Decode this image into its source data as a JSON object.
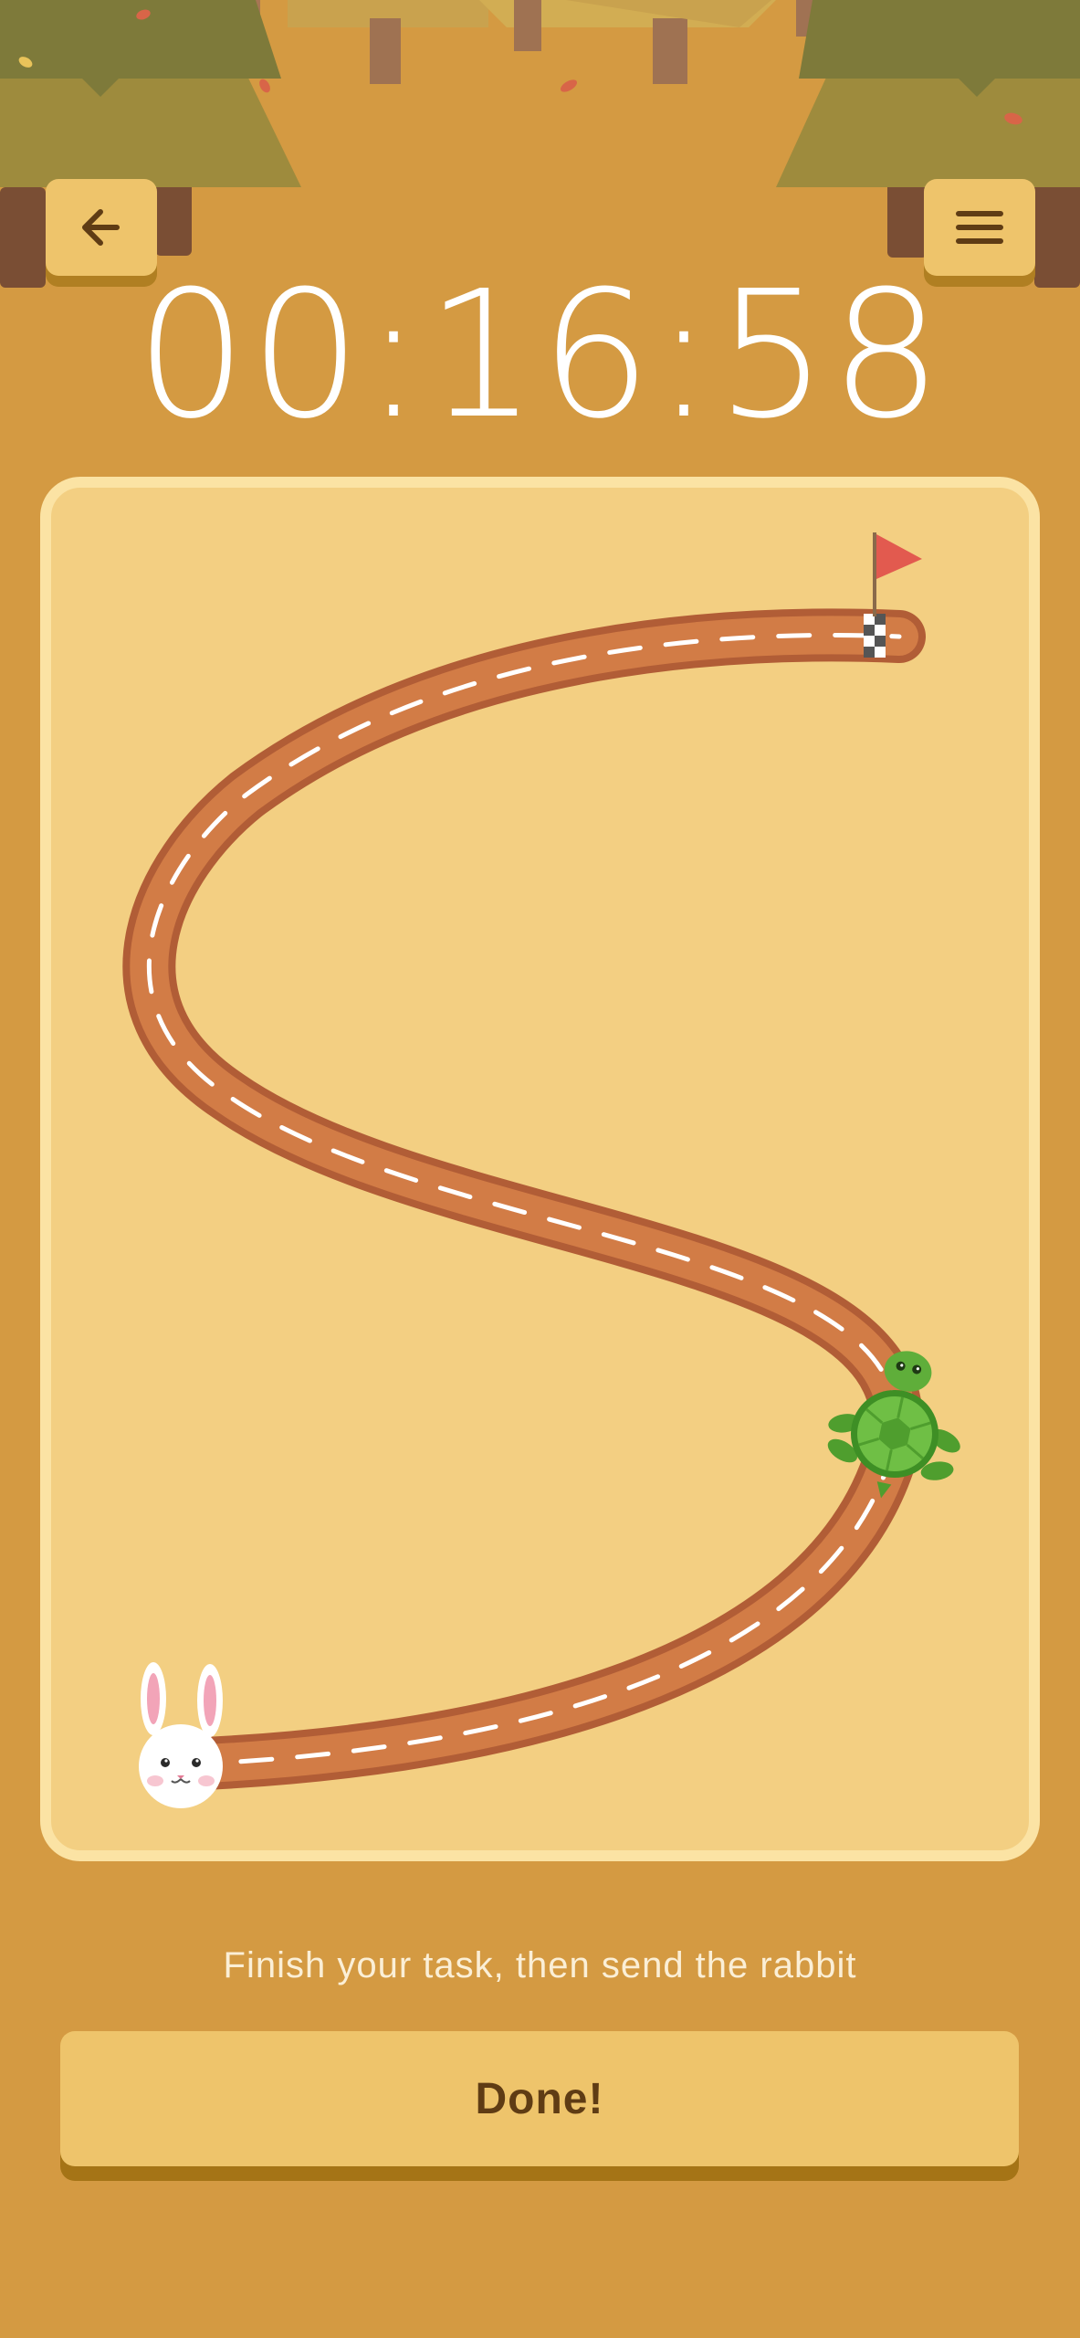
{
  "header": {
    "back_icon": "arrow-left-icon",
    "menu_icon": "hamburger-menu-icon"
  },
  "timer": {
    "value": "00:16:58"
  },
  "race": {
    "start_character": "rabbit",
    "runner_character": "turtle",
    "finish_marker": "red-flag-checkered-finish",
    "turtle_progress_fraction": 0.26
  },
  "footer": {
    "instruction": "Finish your task, then send the rabbit",
    "done_label": "Done!"
  },
  "colors": {
    "background": "#d49a42",
    "board": "#f3cf82",
    "board_border": "#fbe3a4",
    "track": "#d27c46",
    "track_edge": "#b15d36",
    "button": "#eec46b",
    "button_shadow": "#b07f22",
    "flag": "#e25a4f",
    "turtle_shell": "#5fae3a",
    "text_dark": "#5f3c14"
  }
}
